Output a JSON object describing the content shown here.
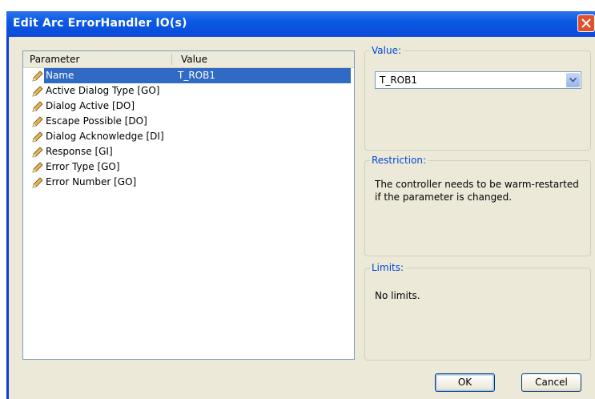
{
  "window": {
    "title": "Edit Arc ErrorHandler IO(s)"
  },
  "list": {
    "columns": [
      "Parameter",
      "Value"
    ],
    "rows": [
      {
        "parameter": "Name",
        "value": "T_ROB1",
        "selected": true
      },
      {
        "parameter": "Active Dialog Type [GO]",
        "value": ""
      },
      {
        "parameter": "Dialog Active [DO]",
        "value": ""
      },
      {
        "parameter": "Escape Possible [DO]",
        "value": ""
      },
      {
        "parameter": "Dialog Acknowledge [DI]",
        "value": ""
      },
      {
        "parameter": "Response [GI]",
        "value": ""
      },
      {
        "parameter": "Error Type [GO]",
        "value": ""
      },
      {
        "parameter": "Error Number [GO]",
        "value": ""
      }
    ]
  },
  "value_group": {
    "title": "Value:",
    "selected": "T_ROB1"
  },
  "restriction_group": {
    "title": "Restriction:",
    "text": "The controller needs to be warm-restarted if the parameter is changed."
  },
  "limits_group": {
    "title": "Limits:",
    "text": "No limits."
  },
  "buttons": {
    "ok": "OK",
    "cancel": "Cancel"
  },
  "colors": {
    "titlebar": "#0a5ae4",
    "selection": "#316ac5",
    "group_title": "#0046d5",
    "dialog_bg": "#ece9d8"
  },
  "icons": {
    "row_icon": "pencil-icon",
    "close": "close-icon",
    "dropdown": "chevron-down-icon"
  }
}
